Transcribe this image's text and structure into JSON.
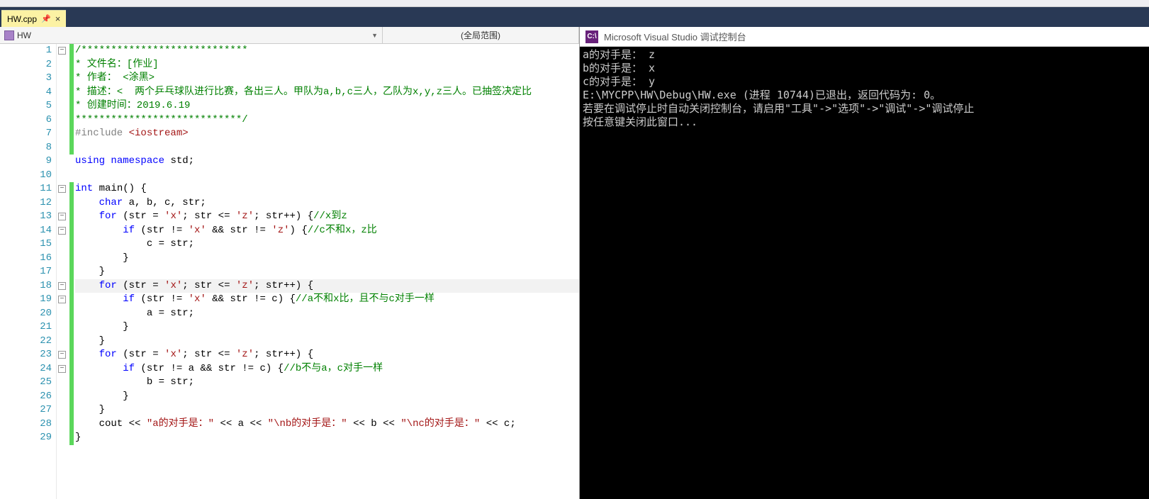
{
  "tab": {
    "label": "HW.cpp"
  },
  "nav": {
    "class_label": "HW",
    "scope_label": "(全局范围)"
  },
  "code": {
    "lines": [
      {
        "n": 1,
        "fold": "-",
        "bar": true,
        "html": "<span class='cmt'>/****************************</span>"
      },
      {
        "n": 2,
        "fold": "",
        "bar": true,
        "html": "<span class='cmt'>* 文件名：[作业]</span>"
      },
      {
        "n": 3,
        "fold": "",
        "bar": true,
        "html": "<span class='cmt'>* 作者： &lt;涂黑&gt;</span>"
      },
      {
        "n": 4,
        "fold": "",
        "bar": true,
        "html": "<span class='cmt'>* 描述：&lt;  两个乒乓球队进行比赛，各出三人。甲队为a,b,c三人，乙队为x,y,z三人。已抽签决定比</span>"
      },
      {
        "n": 5,
        "fold": "",
        "bar": true,
        "html": "<span class='cmt'>* 创建时间：2019.6.19</span>"
      },
      {
        "n": 6,
        "fold": "",
        "bar": true,
        "html": "<span class='cmt'>****************************/</span>"
      },
      {
        "n": 7,
        "fold": "",
        "bar": true,
        "html": "<span class='pp'>#include </span><span class='inc'>&lt;iostream&gt;</span>"
      },
      {
        "n": 8,
        "fold": "",
        "bar": true,
        "html": ""
      },
      {
        "n": 9,
        "fold": "",
        "bar": false,
        "html": "<span class='kw'>using</span> <span class='kw'>namespace</span> std;"
      },
      {
        "n": 10,
        "fold": "",
        "bar": false,
        "html": ""
      },
      {
        "n": 11,
        "fold": "-",
        "bar": true,
        "html": "<span class='kw'>int</span> main() {"
      },
      {
        "n": 12,
        "fold": "",
        "bar": true,
        "html": "    <span class='kw'>char</span> a, b, c, str;"
      },
      {
        "n": 13,
        "fold": "-",
        "bar": true,
        "html": "    <span class='kw'>for</span> (str = <span class='str'>'x'</span>; str &lt;= <span class='str'>'z'</span>; str++) {<span class='cmt'>//x到z</span>"
      },
      {
        "n": 14,
        "fold": "-",
        "bar": true,
        "html": "        <span class='kw'>if</span> (str != <span class='str'>'x'</span> &amp;&amp; str != <span class='str'>'z'</span>) {<span class='cmt'>//c不和x，z比</span>"
      },
      {
        "n": 15,
        "fold": "",
        "bar": true,
        "html": "            c = str;"
      },
      {
        "n": 16,
        "fold": "",
        "bar": true,
        "html": "        }"
      },
      {
        "n": 17,
        "fold": "",
        "bar": true,
        "html": "    }"
      },
      {
        "n": 18,
        "fold": "-",
        "bar": true,
        "html": "    <span class='kw'>for</span> (str = <span class='str'>'x'</span>; str &lt;= <span class='str'>'z'</span>; str++) {",
        "current": true
      },
      {
        "n": 19,
        "fold": "-",
        "bar": true,
        "html": "        <span class='kw'>if</span> (str != <span class='str'>'x'</span> &amp;&amp; str != c) {<span class='cmt'>//a不和x比，且不与c对手一样</span>"
      },
      {
        "n": 20,
        "fold": "",
        "bar": true,
        "html": "            a = str;"
      },
      {
        "n": 21,
        "fold": "",
        "bar": true,
        "html": "        }"
      },
      {
        "n": 22,
        "fold": "",
        "bar": true,
        "html": "    }"
      },
      {
        "n": 23,
        "fold": "-",
        "bar": true,
        "html": "    <span class='kw'>for</span> (str = <span class='str'>'x'</span>; str &lt;= <span class='str'>'z'</span>; str++) {"
      },
      {
        "n": 24,
        "fold": "-",
        "bar": true,
        "html": "        <span class='kw'>if</span> (str != a &amp;&amp; str != c) {<span class='cmt'>//b不与a，c对手一样</span>"
      },
      {
        "n": 25,
        "fold": "",
        "bar": true,
        "html": "            b = str;"
      },
      {
        "n": 26,
        "fold": "",
        "bar": true,
        "html": "        }"
      },
      {
        "n": 27,
        "fold": "",
        "bar": true,
        "html": "    }"
      },
      {
        "n": 28,
        "fold": "",
        "bar": true,
        "html": "    cout &lt;&lt; <span class='str'>\"a的对手是：\"</span> &lt;&lt; a &lt;&lt; <span class='str'>\"\\nb的对手是：\"</span> &lt;&lt; b &lt;&lt; <span class='str'>\"\\nc的对手是：\"</span> &lt;&lt; c;"
      },
      {
        "n": 29,
        "fold": "",
        "bar": true,
        "html": "}"
      }
    ]
  },
  "console": {
    "title": "Microsoft Visual Studio 调试控制台",
    "icon": "C:\\",
    "lines": [
      "a的对手是： z",
      "b的对手是： x",
      "c的对手是： y",
      "E:\\MYCPP\\HW\\Debug\\HW.exe (进程 10744)已退出，返回代码为: 0。",
      "若要在调试停止时自动关闭控制台，请启用\"工具\"->\"选项\"->\"调试\"->\"调试停止",
      "按任意键关闭此窗口..."
    ]
  }
}
